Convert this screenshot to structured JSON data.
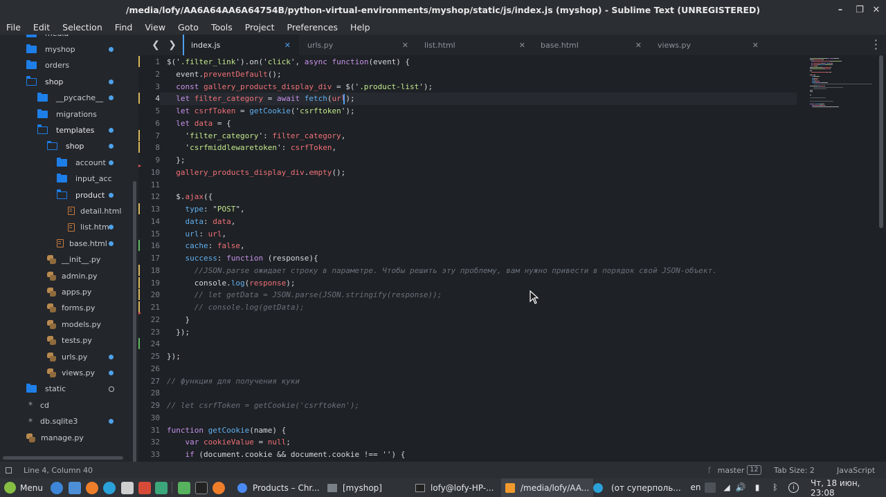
{
  "window": {
    "title": "/media/lofy/AA6A64AA6A64754B/python-virtual-environments/myshop/static/js/index.js (myshop) - Sublime Text (UNREGISTERED)",
    "controls": [
      "–",
      "❐",
      "✕"
    ]
  },
  "menu": [
    "File",
    "Edit",
    "Selection",
    "Find",
    "View",
    "Goto",
    "Tools",
    "Project",
    "Preferences",
    "Help"
  ],
  "sidebar": {
    "items": [
      {
        "label": "media",
        "icon": "folder-closed-icon",
        "depth": 0
      },
      {
        "label": "myshop",
        "icon": "folder-closed-icon",
        "depth": 0,
        "dot": "filled"
      },
      {
        "label": "orders",
        "icon": "folder-closed-icon",
        "depth": 0
      },
      {
        "label": "shop",
        "icon": "folder-open-icon",
        "depth": 0,
        "dot": "filled"
      },
      {
        "label": "__pycache__",
        "icon": "folder-closed-icon",
        "depth": 1,
        "dot": "filled"
      },
      {
        "label": "migrations",
        "icon": "folder-closed-icon",
        "depth": 1
      },
      {
        "label": "templates",
        "icon": "folder-open-icon",
        "depth": 1,
        "dot": "filled"
      },
      {
        "label": "shop",
        "icon": "folder-open-icon",
        "depth": 2,
        "dot": "filled"
      },
      {
        "label": "account",
        "icon": "folder-closed-icon",
        "depth": 3,
        "dot": "filled"
      },
      {
        "label": "input_acc",
        "icon": "folder-closed-icon",
        "depth": 3
      },
      {
        "label": "product",
        "icon": "folder-open-icon",
        "depth": 3,
        "dot": "filled"
      },
      {
        "label": "detail.html",
        "icon": "html-file-icon",
        "depth": 4
      },
      {
        "label": "list.htm",
        "icon": "html-file-icon",
        "depth": 4,
        "dot": "filled"
      },
      {
        "label": "base.html",
        "icon": "html-file-icon",
        "depth": 3,
        "dot": "filled"
      },
      {
        "label": "__init__.py",
        "icon": "python-file-icon",
        "depth": 2
      },
      {
        "label": "admin.py",
        "icon": "python-file-icon",
        "depth": 2
      },
      {
        "label": "apps.py",
        "icon": "python-file-icon",
        "depth": 2
      },
      {
        "label": "forms.py",
        "icon": "python-file-icon",
        "depth": 2
      },
      {
        "label": "models.py",
        "icon": "python-file-icon",
        "depth": 2
      },
      {
        "label": "tests.py",
        "icon": "python-file-icon",
        "depth": 2
      },
      {
        "label": "urls.py",
        "icon": "python-file-icon",
        "depth": 2,
        "dot": "filled"
      },
      {
        "label": "views.py",
        "icon": "python-file-icon",
        "depth": 2,
        "dot": "filled"
      },
      {
        "label": "static",
        "icon": "folder-closed-icon",
        "depth": 0,
        "dot": "hollow"
      },
      {
        "label": "cd",
        "icon": "asterisk-file-icon",
        "depth": 0
      },
      {
        "label": "db.sqlite3",
        "icon": "asterisk-file-icon",
        "depth": 0,
        "dot": "filled"
      },
      {
        "label": "manage.py",
        "icon": "python-file-icon",
        "depth": 0
      }
    ]
  },
  "tabs": [
    {
      "label": "index.js",
      "active": true
    },
    {
      "label": "urls.py",
      "active": false
    },
    {
      "label": "list.html",
      "active": false
    },
    {
      "label": "base.html",
      "active": false
    },
    {
      "label": "views.py",
      "active": false
    }
  ],
  "colors": {
    "keyword": "#c792ea",
    "function": "#61afef",
    "string": "#c3e88d",
    "variable": "#f07178",
    "comment": "#6a717c",
    "text": "#d5d8dc",
    "accent": "#4e9ff0"
  },
  "code_lines": [
    {
      "n": "1",
      "mark": "yellow",
      "tokens": [
        [
          "$('",
          ""
        ],
        [
          ".filter_link",
          "s"
        ],
        [
          "').on('",
          ""
        ],
        [
          "click",
          "s"
        ],
        [
          "', ",
          ""
        ],
        [
          "async",
          "k"
        ],
        [
          " ",
          ""
        ],
        [
          "function",
          "k"
        ],
        [
          "(event) {",
          ""
        ]
      ]
    },
    {
      "n": "2",
      "tokens": [
        [
          "  event.",
          ""
        ],
        [
          "preventDefault",
          "v"
        ],
        [
          "();",
          ""
        ]
      ]
    },
    {
      "n": "3",
      "tokens": [
        [
          "  ",
          ""
        ],
        [
          "const",
          "k"
        ],
        [
          " ",
          ""
        ],
        [
          "gallery_products_display_div",
          "v"
        ],
        [
          " = $('",
          ""
        ],
        [
          ".product-list",
          "s"
        ],
        [
          "');",
          ""
        ]
      ]
    },
    {
      "n": "4",
      "mark": "yellow",
      "current": true,
      "tokens": [
        [
          "  ",
          ""
        ],
        [
          "let",
          "k"
        ],
        [
          " ",
          ""
        ],
        [
          "filter_category",
          "v"
        ],
        [
          " = ",
          ""
        ],
        [
          "await",
          "k"
        ],
        [
          " ",
          ""
        ],
        [
          "fetch",
          "f"
        ],
        [
          "(",
          ""
        ],
        [
          "url",
          "v"
        ],
        [
          ");",
          ""
        ]
      ]
    },
    {
      "n": "5",
      "tokens": [
        [
          "  ",
          ""
        ],
        [
          "let",
          "k"
        ],
        [
          " ",
          ""
        ],
        [
          "csrfToken",
          "v"
        ],
        [
          " = ",
          ""
        ],
        [
          "getCookie",
          "f"
        ],
        [
          "('",
          ""
        ],
        [
          "csrftoken",
          "s"
        ],
        [
          "');",
          ""
        ]
      ]
    },
    {
      "n": "6",
      "tokens": [
        [
          "  ",
          ""
        ],
        [
          "let",
          "k"
        ],
        [
          " ",
          ""
        ],
        [
          "data",
          "v"
        ],
        [
          " = {",
          ""
        ]
      ]
    },
    {
      "n": "7",
      "mark": "yellow",
      "tokens": [
        [
          "    '",
          ""
        ],
        [
          "filter_category",
          "s"
        ],
        [
          "': ",
          ""
        ],
        [
          "filter_category",
          "v"
        ],
        [
          ",",
          ""
        ]
      ]
    },
    {
      "n": "8",
      "mark": "yellow",
      "tokens": [
        [
          "    '",
          ""
        ],
        [
          "csrfmiddlewaretoken",
          "s"
        ],
        [
          "': ",
          ""
        ],
        [
          "csrfToken",
          "v"
        ],
        [
          ",",
          ""
        ]
      ]
    },
    {
      "n": "9",
      "tokens": [
        [
          "  };",
          ""
        ]
      ]
    },
    {
      "n": "10",
      "fold": true,
      "tokens": [
        [
          "  ",
          ""
        ],
        [
          "gallery_products_display_div",
          "v"
        ],
        [
          ".",
          ""
        ],
        [
          "empty",
          "v"
        ],
        [
          "();",
          ""
        ]
      ]
    },
    {
      "n": "11",
      "tokens": []
    },
    {
      "n": "12",
      "tokens": [
        [
          "  $.",
          ""
        ],
        [
          "ajax",
          "v"
        ],
        [
          "({",
          ""
        ]
      ]
    },
    {
      "n": "13",
      "mark": "yellow",
      "tokens": [
        [
          "    ",
          ""
        ],
        [
          "type",
          "f"
        ],
        [
          ": \"",
          ""
        ],
        [
          "POST",
          "s"
        ],
        [
          "\",",
          ""
        ]
      ]
    },
    {
      "n": "14",
      "tokens": [
        [
          "    ",
          ""
        ],
        [
          "data",
          "f"
        ],
        [
          ": ",
          ""
        ],
        [
          "data",
          "v"
        ],
        [
          ",",
          ""
        ]
      ]
    },
    {
      "n": "15",
      "tokens": [
        [
          "    ",
          ""
        ],
        [
          "url",
          "f"
        ],
        [
          ": ",
          ""
        ],
        [
          "url",
          "v"
        ],
        [
          ",",
          ""
        ]
      ]
    },
    {
      "n": "16",
      "mark": "green",
      "tokens": [
        [
          "    ",
          ""
        ],
        [
          "cache",
          "f"
        ],
        [
          ": ",
          ""
        ],
        [
          "false",
          "v"
        ],
        [
          ",",
          ""
        ]
      ]
    },
    {
      "n": "17",
      "tokens": [
        [
          "    ",
          ""
        ],
        [
          "success",
          "f"
        ],
        [
          ": ",
          ""
        ],
        [
          "function",
          "k"
        ],
        [
          " (response){",
          ""
        ]
      ]
    },
    {
      "n": "18",
      "mark": "yellow",
      "tokens": [
        [
          "      ",
          ""
        ],
        [
          "//JSON.parse ожидает строку в параметре. Чтобы решить эту проблему, вам нужно привести в порядок свой JSON-объект.",
          "c"
        ]
      ]
    },
    {
      "n": "19",
      "mark": "yellow",
      "tokens": [
        [
          "      console.",
          ""
        ],
        [
          "log",
          "f"
        ],
        [
          "(",
          ""
        ],
        [
          "response",
          "v"
        ],
        [
          ");",
          ""
        ]
      ]
    },
    {
      "n": "20",
      "mark": "yellow",
      "tokens": [
        [
          "      ",
          ""
        ],
        [
          "// let getData = JSON.parse(JSON.stringify(response));",
          "c"
        ]
      ]
    },
    {
      "n": "21",
      "mark": "yellow",
      "tokens": [
        [
          "      ",
          ""
        ],
        [
          "// console.log(getData);",
          "c"
        ]
      ]
    },
    {
      "n": "22",
      "fold": true,
      "tokens": [
        [
          "    }",
          ""
        ]
      ]
    },
    {
      "n": "23",
      "tokens": [
        [
          "  });",
          ""
        ]
      ]
    },
    {
      "n": "24",
      "mark": "green",
      "tokens": []
    },
    {
      "n": "25",
      "tokens": [
        [
          "});",
          ""
        ]
      ]
    },
    {
      "n": "26",
      "tokens": []
    },
    {
      "n": "27",
      "tokens": [
        [
          "// функция для получения куки",
          "c"
        ]
      ]
    },
    {
      "n": "28",
      "tokens": []
    },
    {
      "n": "29",
      "tokens": [
        [
          "// let csrfToken = getCookie('csrftoken');",
          "c"
        ]
      ]
    },
    {
      "n": "30",
      "tokens": []
    },
    {
      "n": "31",
      "tokens": [
        [
          "function",
          "k"
        ],
        [
          " ",
          ""
        ],
        [
          "getCookie",
          "f"
        ],
        [
          "(name) {",
          ""
        ]
      ]
    },
    {
      "n": "32",
      "tokens": [
        [
          "    ",
          ""
        ],
        [
          "var",
          "k"
        ],
        [
          " ",
          ""
        ],
        [
          "cookieValue",
          "v"
        ],
        [
          " = ",
          ""
        ],
        [
          "null",
          "v"
        ],
        [
          ";",
          ""
        ]
      ]
    },
    {
      "n": "33",
      "tokens": [
        [
          "    ",
          ""
        ],
        [
          "if",
          "k"
        ],
        [
          " (document.cookie && document.cookie !== '') {",
          ""
        ]
      ]
    }
  ],
  "status": {
    "position": "Line 4, Column 40",
    "branch": "master",
    "branch_count": "12",
    "tab_size": "Tab Size: 2",
    "syntax": "JavaScript"
  },
  "taskbar": {
    "menu_label": "Menu",
    "windows": [
      "Products – Chr...",
      "[myshop]",
      "lofy@lofy-HP-...",
      "/media/lofy/AA...",
      "(от суперполь..."
    ],
    "lang": "en",
    "clock": "Чт, 18 июн, 23:08"
  }
}
